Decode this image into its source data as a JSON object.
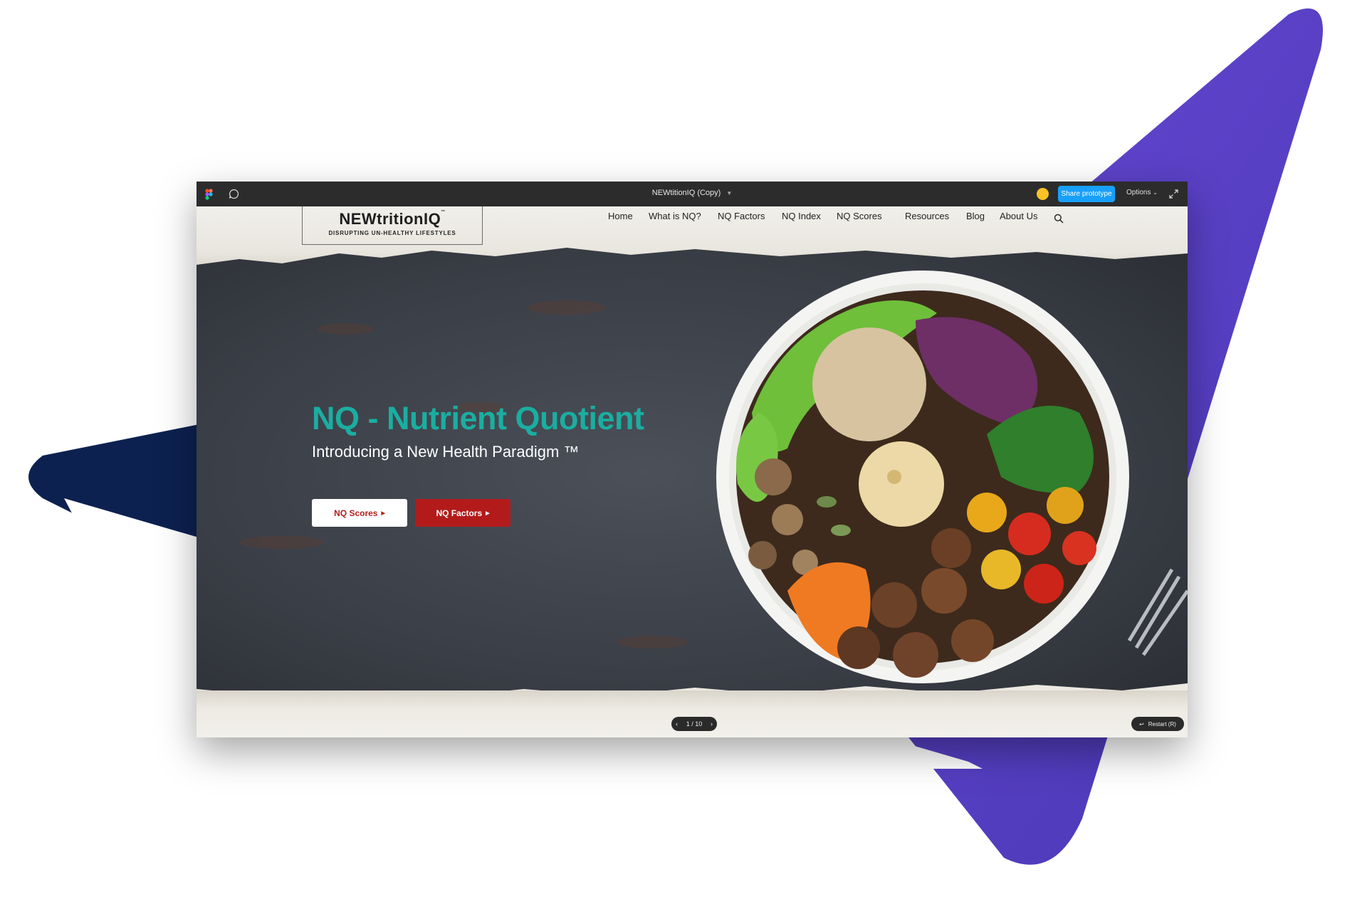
{
  "figma": {
    "doc_title": "NEWtitionIQ (Copy)",
    "share_label": "Share prototype",
    "options_label": "Options",
    "avatar_color": "#f7c325",
    "share_color": "#18a0fb"
  },
  "site": {
    "logo": {
      "name": "NEWtritionIQ",
      "tm": "™",
      "tagline": "DISRUPTING  UN-HEALTHY  LIFESTYLES"
    },
    "nav": [
      "Home",
      "What is NQ?",
      "NQ Factors",
      "NQ Index",
      "NQ Scores",
      "Resources",
      "Blog",
      "About Us"
    ],
    "hero": {
      "title": "NQ - Nutrient Quotient",
      "subtitle": "Introducing a New Health Paradigm ™",
      "title_color": "#1aaea0"
    },
    "buttons": {
      "scores": "NQ Scores",
      "factors": "NQ Factors",
      "factors_color": "#b31b1b"
    }
  },
  "prototype_controls": {
    "page_indicator": "1 / 10",
    "restart_label": "Restart (R)"
  },
  "decor": {
    "purple": "#5b45c9",
    "navy": "#0d2150"
  }
}
